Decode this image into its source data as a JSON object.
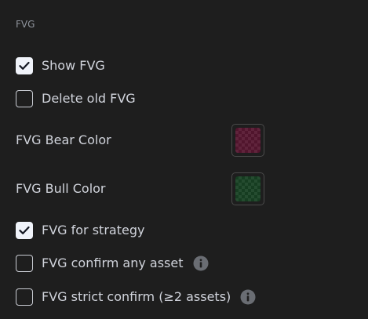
{
  "section": {
    "title": "FVG"
  },
  "options": [
    {
      "label": "Show FVG",
      "checked": true,
      "info": false
    },
    {
      "label": "Delete old FVG",
      "checked": false,
      "info": false
    }
  ],
  "colors": [
    {
      "label": "FVG Bear Color",
      "value": "#c2185b"
    },
    {
      "label": "FVG Bull Color",
      "value": "#1b8a3a"
    }
  ],
  "options2": [
    {
      "label": "FVG for strategy",
      "checked": true,
      "info": false
    },
    {
      "label": "FVG confirm any asset",
      "checked": false,
      "info": true
    },
    {
      "label": "FVG strict confirm (≥2 assets)",
      "checked": false,
      "info": true
    }
  ],
  "theme": {
    "background": "#1e1e1e",
    "text": "#d1d4dc",
    "muted": "#8f949c"
  }
}
